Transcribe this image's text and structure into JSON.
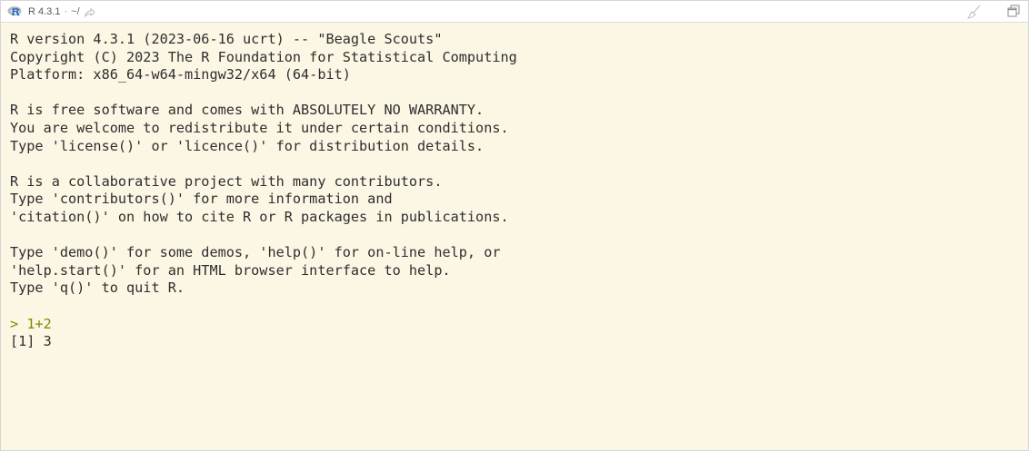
{
  "toolbar": {
    "r_version": "R 4.3.1",
    "separator": "·",
    "working_dir": "~/",
    "icons": {
      "logo": "r-logo-icon",
      "goto_dir": "goto-directory-icon",
      "clear": "broom-clear-icon",
      "maximize": "maximize-icon"
    }
  },
  "console": {
    "startup": [
      "R version 4.3.1 (2023-06-16 ucrt) -- \"Beagle Scouts\"",
      "Copyright (C) 2023 The R Foundation for Statistical Computing",
      "Platform: x86_64-w64-mingw32/x64 (64-bit)",
      "",
      "R is free software and comes with ABSOLUTELY NO WARRANTY.",
      "You are welcome to redistribute it under certain conditions.",
      "Type 'license()' or 'licence()' for distribution details.",
      "",
      "R is a collaborative project with many contributors.",
      "Type 'contributors()' for more information and",
      "'citation()' on how to cite R or R packages in publications.",
      "",
      "Type 'demo()' for some demos, 'help()' for on-line help, or",
      "'help.start()' for an HTML browser interface to help.",
      "Type 'q()' to quit R.",
      ""
    ],
    "prompt": ">",
    "command": "1+2",
    "output": "[1] 3"
  },
  "colors": {
    "console_background": "#fcf6e4",
    "console_text": "#2e2e2e",
    "command_text": "#7c8a00",
    "toolbar_background": "#ffffff",
    "r_logo_blue": "#276dc3"
  }
}
